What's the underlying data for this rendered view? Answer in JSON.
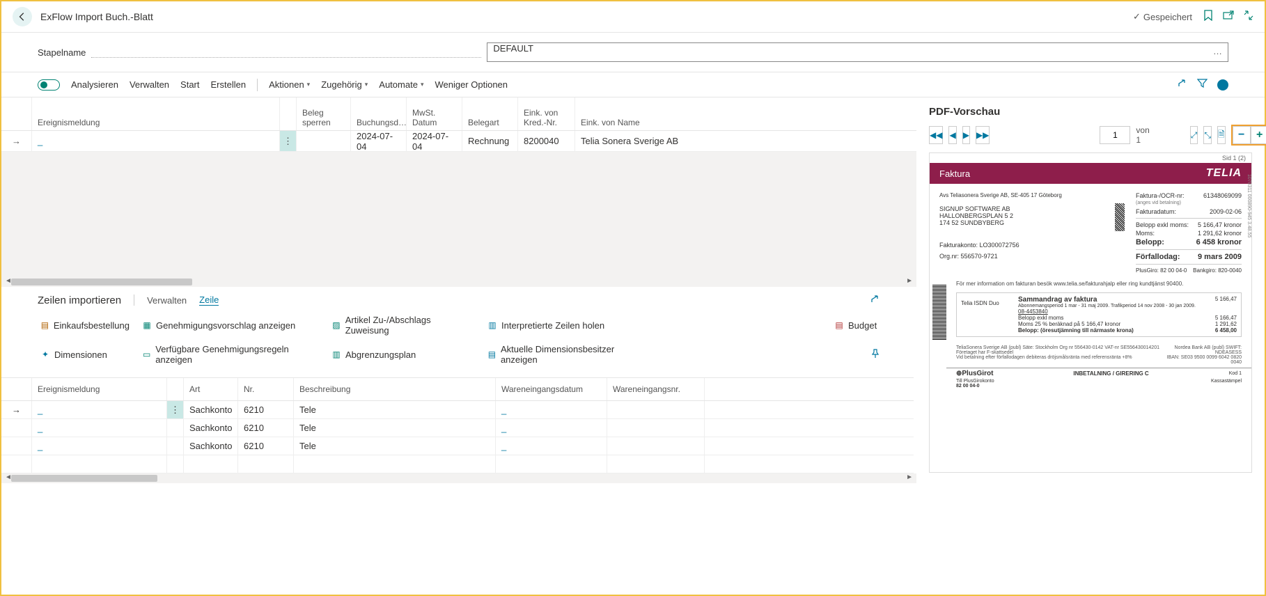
{
  "header": {
    "title": "ExFlow Import Buch.-Blatt",
    "saved_label": "Gespeichert"
  },
  "stapel": {
    "label": "Stapelname",
    "value": "DEFAULT"
  },
  "toolbar": {
    "analyze": "Analysieren",
    "manage": "Verwalten",
    "start": "Start",
    "create": "Erstellen",
    "actions": "Aktionen",
    "related": "Zugehörig",
    "automate": "Automate",
    "fewer": "Weniger Optionen"
  },
  "grid": {
    "headers": {
      "event": "Ereignismeldung",
      "lock": "Beleg sperren",
      "posting_date": "Buchungsd…",
      "vat_date": "MwSt. Datum",
      "doc_type": "Belegart",
      "vendor_no": "Eink. von Kred.-Nr.",
      "vendor_name": "Eink. von Name"
    },
    "row": {
      "event": "_",
      "posting_date": "2024-07-04",
      "vat_date": "2024-07-04",
      "doc_type": "Rechnung",
      "vendor_no": "8200040",
      "vendor_name": "Telia Sonera Sverige AB"
    }
  },
  "sub": {
    "title": "Zeilen importieren",
    "manage": "Verwalten",
    "line": "Zeile"
  },
  "actions": {
    "purchase_order": "Einkaufsbestellung",
    "approval": "Genehmigungsvorschlag anzeigen",
    "item_charge": "Artikel Zu-/Abschlags Zuweisung",
    "interpreted": "Interpretierte Zeilen holen",
    "budget": "Budget",
    "dimensions": "Dimensionen",
    "approval_rules": "Verfügbare Genehmigungsregeln anzeigen",
    "deferral": "Abgrenzungsplan",
    "dim_owners": "Aktuelle Dimensionsbesitzer anzeigen"
  },
  "lines": {
    "headers": {
      "event": "Ereignismeldung",
      "type": "Art",
      "no": "Nr.",
      "desc": "Beschreibung",
      "wr_date": "Wareneingangsdatum",
      "wr_no": "Wareneingangsnr."
    },
    "rows": [
      {
        "event": "_",
        "type": "Sachkonto",
        "no": "6210",
        "desc": "Tele",
        "wr_date": "_"
      },
      {
        "event": "_",
        "type": "Sachkonto",
        "no": "6210",
        "desc": "Tele",
        "wr_date": "_"
      },
      {
        "event": "_",
        "type": "Sachkonto",
        "no": "6210",
        "desc": "Tele",
        "wr_date": "_"
      }
    ]
  },
  "pdf": {
    "title": "PDF-Vorschau",
    "page": "1",
    "of_label": "von 1",
    "page_label": "Sid 1 (2)",
    "invoice_label": "Faktura",
    "brand": "TELIA",
    "sender": "Avs Teliasonera Sverige AB, SE-405 17 Göteborg",
    "recipient_l1": "SIGNUP SOFTWARE AB",
    "recipient_l2": "HALLONBERGSPLAN 5 2",
    "recipient_l3": "174 52  SUNDBYBERG",
    "inv_no_label": "Faktura-/OCR-nr:",
    "inv_no_sub": "(anges vid betalning)",
    "inv_no": "61348069099",
    "inv_date_label": "Fakturadatum:",
    "inv_date": "2009-02-06",
    "excl_label": "Belopp exkl moms:",
    "excl": "5 166,47 kronor",
    "vat_label": "Moms:",
    "vat": "1 291,62 kronor",
    "total_label": "Belopp:",
    "total": "6 458 kronor",
    "due_label": "Förfallodag:",
    "due": "9 mars 2009",
    "acct_label": "Fakturakonto:",
    "acct": "LO300072756",
    "org_label": "Org.nr:",
    "org": "556570-9721",
    "plusgiro": "PlusGiro: 82 00 04-0",
    "bankgiro": "Bankgiro: 820-0040",
    "info_text": "För mer information om fakturan besök www.telia.se/fakturahjalp eller ring kundtjänst 90400.",
    "summary_product": "Telia ISDN Duo",
    "summary_title": "Sammandrag av faktura",
    "summary_period": "Abonnemangsperiod 1 mar - 31 maj 2009. Trafikperiod 14 nov 2008 - 30 jan 2009.",
    "summary_phone": "08-4453840",
    "summary_r1l": "Belopp exkl moms",
    "summary_r1v": "5 166,47",
    "summary_r0v": "5 166,47",
    "summary_r2l": "Moms 25 % beräknad på 5 166,47 kronor",
    "summary_r2v": "1 291,62",
    "summary_r3l": "Belopp: (öresutjämning till närmaste krona)",
    "summary_r3v": "6 458,00",
    "foot_left": "TeliaSonera Sverige AB (publ)  Säte: Stockholm  Org nr 556430-0142  VAT-nr SE556430014201  Företaget har F-skattsedel\nVid betalning efter förfallodagen debiteras dröjsmålsränta med referensränta +8%",
    "foot_right": "Nordea Bank AB (publ)  SWIFT: NDEASESS\nIBAN: SE03 9500 0099 6042 0820 0040",
    "plusgirot": "PlusGirot",
    "giro_label": "INBETALNING / GIRERING C",
    "kod": "Kod 1",
    "till": "Till PlusGirokonto",
    "till_no": "82 00 04-0",
    "kassa": "Kassastämpel"
  }
}
